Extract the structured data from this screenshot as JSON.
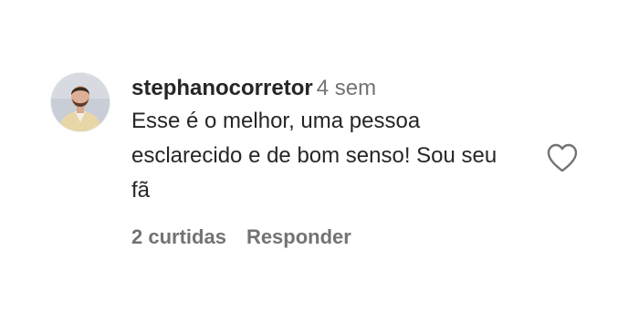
{
  "comment": {
    "username": "stephanocorretor",
    "time": "4 sem",
    "text": "Esse é o melhor, uma pessoa esclarecido e de bom senso! Sou seu fã",
    "likes": "2 curtidas",
    "reply_label": "Responder",
    "avatar_icon": "profile-photo",
    "like_icon": "heart-outline-icon"
  }
}
